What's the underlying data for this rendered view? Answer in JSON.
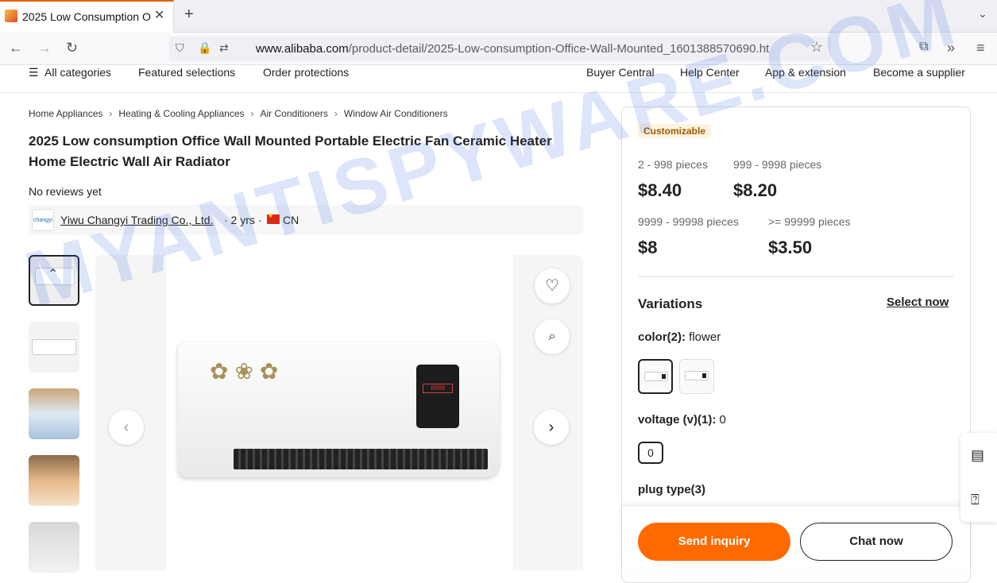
{
  "browser": {
    "tab_title": "2025 Low Consumption O",
    "tab_close": "✕",
    "new_tab": "+",
    "url_domain": "www.alibaba.com",
    "url_path": "/product-detail/2025-Low-consumption-Office-Wall-Mounted_1601388570690.ht"
  },
  "topnav": {
    "all_categories": "All categories",
    "featured": "Featured selections",
    "order_protections": "Order protections",
    "buyer_central": "Buyer Central",
    "help_center": "Help Center",
    "app_extension": "App & extension",
    "become_supplier": "Become a supplier"
  },
  "breadcrumb": [
    "Home Appliances",
    "Heating & Cooling Appliances",
    "Air Conditioners",
    "Window Air Conditioners"
  ],
  "product": {
    "title": "2025 Low consumption Office Wall Mounted Portable Electric Fan Ceramic Heater Home Electric Wall Air Radiator",
    "reviews": "No reviews yet"
  },
  "supplier": {
    "logo_text": "changyi",
    "name": "Yiwu Changyi Trading Co., Ltd.",
    "years": "· 2 yrs ·",
    "country": "CN"
  },
  "pricing": {
    "badge": "Customizable",
    "tiers": [
      {
        "range": "2 - 998 pieces",
        "price": "$8.40"
      },
      {
        "range": "999 - 9998 pieces",
        "price": "$8.20"
      },
      {
        "range": "9999 - 99998 pieces",
        "price": "$8"
      },
      {
        "range": ">= 99999 pieces",
        "price": "$3.50"
      }
    ]
  },
  "variations": {
    "heading": "Variations",
    "select_now": "Select now",
    "color_label": "color(2):",
    "color_value": "flower",
    "voltage_label": "voltage (v)(1):",
    "voltage_value": "0",
    "voltage_option": "0",
    "plug_label": "plug type(3)"
  },
  "actions": {
    "send_inquiry": "Send inquiry",
    "chat_now": "Chat now"
  },
  "watermark": "MYANTISPYWARE.COM",
  "colors": {
    "accent": "#ff6a00",
    "tab_accent": "#e66000"
  }
}
